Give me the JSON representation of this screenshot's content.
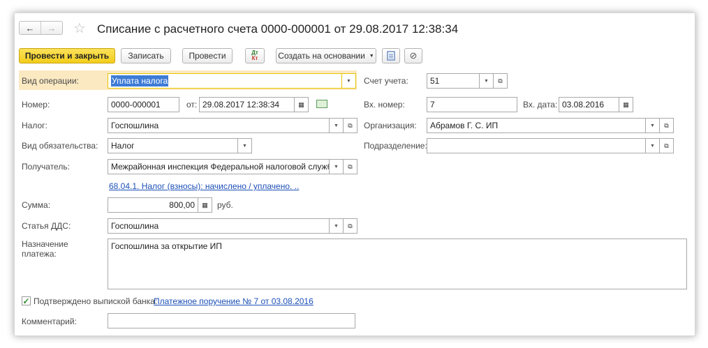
{
  "window": {
    "title": "Списание с расчетного счета 0000-000001 от 29.08.2017 12:38:34"
  },
  "toolbar": {
    "post_close": "Провести и закрыть",
    "save": "Записать",
    "post": "Провести",
    "create_based": "Создать на основании"
  },
  "form": {
    "operation_type": {
      "label": "Вид операции:",
      "value": "Уплата налога"
    },
    "account": {
      "label": "Счет учета:",
      "value": "51"
    },
    "number": {
      "label": "Номер:",
      "value": "0000-000001"
    },
    "date": {
      "label": "от:",
      "value": "29.08.2017 12:38:34"
    },
    "in_number": {
      "label": "Вх. номер:",
      "value": "7"
    },
    "in_date": {
      "label": "Вх. дата:",
      "value": "03.08.2016"
    },
    "tax": {
      "label": "Налог:",
      "value": "Госпошлина"
    },
    "organization": {
      "label": "Организация:",
      "value": "Абрамов Г. С. ИП"
    },
    "obligation": {
      "label": "Вид обязательства:",
      "value": "Налог"
    },
    "department": {
      "label": "Подразделение:",
      "value": ""
    },
    "recipient": {
      "label": "Получатель:",
      "value": "Межрайонная инспекция Федеральной налоговой службы N"
    },
    "account_link": "68.04.1. Налог (взносы): начислено / уплачено. ..",
    "amount": {
      "label": "Сумма:",
      "value": "800,00",
      "currency": "руб."
    },
    "cash_flow": {
      "label": "Статья ДДС:",
      "value": "Госпошлина"
    },
    "purpose": {
      "label_line1": "Назначение",
      "label_line2": "платежа:",
      "value": "Госпошлина за открытие ИП"
    },
    "bank_confirmed": {
      "label": "Подтверждено выпиской банка:",
      "checked": true,
      "link": "Платежное поручение № 7 от 03.08.2016"
    },
    "comment": {
      "label": "Комментарий:",
      "value": ""
    }
  }
}
